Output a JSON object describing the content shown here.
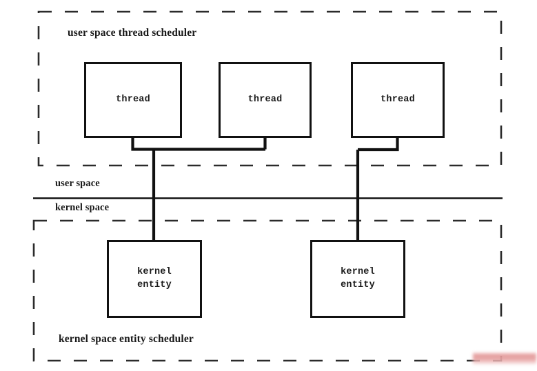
{
  "diagram": {
    "title_user_region": "user space thread scheduler",
    "title_kernel_region": "kernel space entity scheduler",
    "boundary_labels": {
      "upper": "user space",
      "lower": "kernel space"
    },
    "colors": {
      "stroke": "#111111",
      "text": "#1a1a1a",
      "background": "#ffffff",
      "redaction": "#e29696"
    },
    "nodes": {
      "threads": [
        {
          "label": "thread"
        },
        {
          "label": "thread"
        },
        {
          "label": "thread"
        }
      ],
      "kernel_entities": [
        {
          "label": "kernel\nentity"
        },
        {
          "label": "kernel\nentity"
        }
      ]
    }
  }
}
